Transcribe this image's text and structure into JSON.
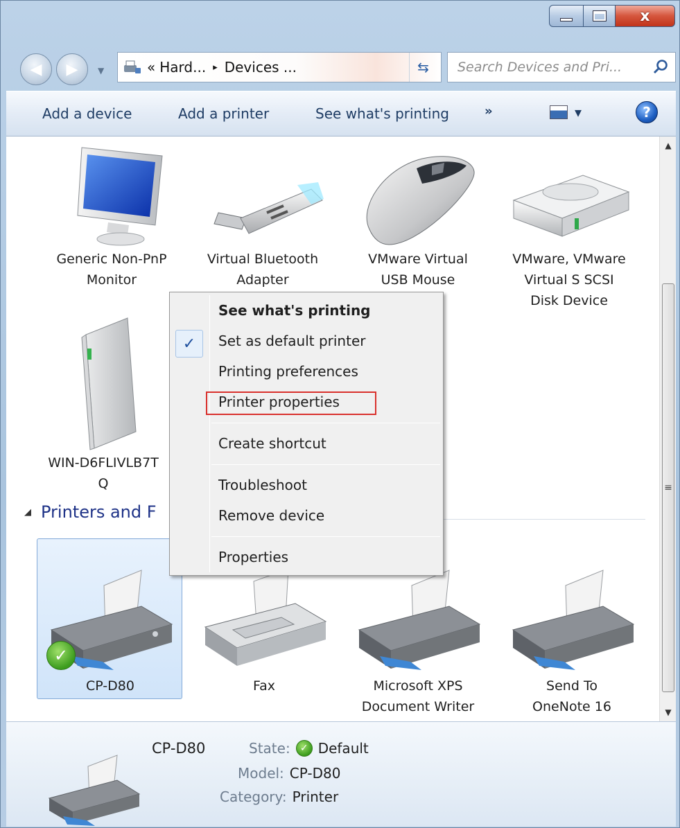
{
  "window": {
    "controls": {
      "minimize": "minimize-icon",
      "maximize": "maximize-icon",
      "close": "close-icon",
      "close_glyph": "x"
    }
  },
  "nav": {
    "back_icon": "back-arrow-icon",
    "forward_icon": "forward-arrow-icon",
    "address": {
      "prefix": "«",
      "segment1": "Hard...",
      "separator": "▸",
      "segment2": "Devices ...",
      "dropdown": "▾"
    },
    "search_placeholder": "Search Devices and Pri..."
  },
  "toolbar": {
    "add_device": "Add a device",
    "add_printer": "Add a printer",
    "see_printing": "See what's printing",
    "more": "»",
    "view_dropdown": "▾",
    "help": "?"
  },
  "devices": [
    {
      "line1": "Generic Non-PnP",
      "line2": "Monitor",
      "icon": "monitor-icon"
    },
    {
      "line1": "Virtual Bluetooth",
      "line2": "Adapter",
      "icon": "usb-bluetooth-icon"
    },
    {
      "line1": "VMware Virtual",
      "line2": "USB Mouse",
      "icon": "mouse-icon"
    },
    {
      "line1": "VMware, VMware",
      "line2": "Virtual S SCSI",
      "line3": "Disk Device",
      "icon": "disk-drive-icon"
    },
    {
      "line1": "WIN-D6FLIVLB7T",
      "line2": "Q",
      "icon": "computer-tower-icon"
    }
  ],
  "printers_section": {
    "title": "Printers and F",
    "collapse_icon": "◢"
  },
  "printers": [
    {
      "line1": "CP-D80",
      "icon": "printer-icon",
      "default": true
    },
    {
      "line1": "Fax",
      "icon": "fax-icon"
    },
    {
      "line1": "Microsoft XPS",
      "line2": "Document Writer",
      "icon": "printer-icon"
    },
    {
      "line1": "Send To",
      "line2": "OneNote 16",
      "icon": "printer-icon"
    }
  ],
  "context_menu": {
    "see_printing": "See what's printing",
    "check": "✓",
    "set_default": "Set as default printer",
    "preferences": "Printing preferences",
    "printer_properties": "Printer properties",
    "create_shortcut": "Create shortcut",
    "troubleshoot": "Troubleshoot",
    "remove_device": "Remove device",
    "properties": "Properties"
  },
  "details": {
    "name": "CP-D80",
    "state_key": "State:",
    "state_val": "Default",
    "model_key": "Model:",
    "model_val": "CP-D80",
    "category_key": "Category:",
    "category_val": "Printer"
  },
  "scrollbar": {
    "up": "▲",
    "down": "▼",
    "grip": "≡"
  },
  "colors": {
    "accent": "#1e3287",
    "selection": "#d0e4f9",
    "highlight_box": "#d9302c"
  }
}
